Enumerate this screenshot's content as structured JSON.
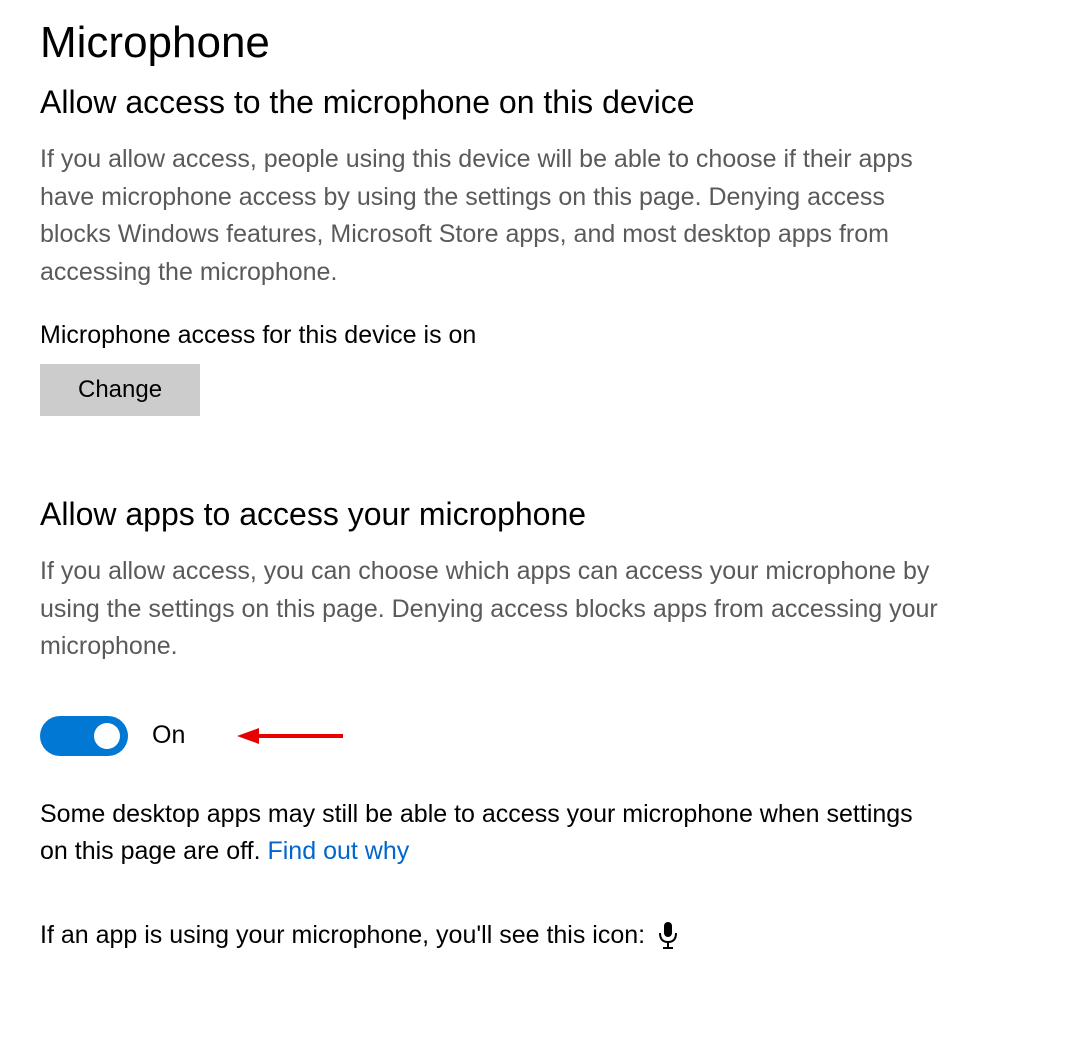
{
  "page": {
    "title": "Microphone"
  },
  "section1": {
    "heading": "Allow access to the microphone on this device",
    "description": "If you allow access, people using this device will be able to choose if their apps have microphone access by using the settings on this page. Denying access blocks Windows features, Microsoft Store apps, and most desktop apps from accessing the microphone.",
    "status": "Microphone access for this device is on",
    "change_button": "Change"
  },
  "section2": {
    "heading": "Allow apps to access your microphone",
    "description": "If you allow access, you can choose which apps can access your microphone by using the settings on this page. Denying access blocks apps from accessing your microphone.",
    "toggle_state": "On",
    "note_text_before": "Some desktop apps may still be able to access your microphone when settings on this page are off. ",
    "note_link": "Find out why",
    "icon_text": "If an app is using your microphone, you'll see this icon:"
  }
}
